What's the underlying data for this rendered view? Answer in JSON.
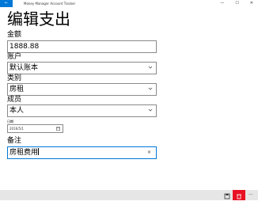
{
  "window": {
    "back_icon": "back-arrow-icon",
    "back_glyph": "←",
    "title": "Money Manager Account Tracker",
    "minimize_glyph": "—",
    "maximize_glyph": "☐",
    "close_glyph": "✕"
  },
  "page": {
    "title": "编辑支出"
  },
  "form": {
    "amount": {
      "label": "金额",
      "value": "1888.88"
    },
    "account": {
      "label": "账户",
      "value": "默认账本"
    },
    "category": {
      "label": "类别",
      "value": "房租"
    },
    "member": {
      "label": "成员",
      "value": "本人"
    },
    "date": {
      "label": "日期",
      "value": "2016/5/1"
    },
    "note": {
      "label": "备注",
      "value": "房租费用",
      "clear_glyph": "×"
    }
  },
  "commandbar": {
    "save_icon": "save-icon",
    "delete_icon": "delete-icon",
    "more_glyph": "···",
    "accent_delete": "#e81123"
  },
  "colors": {
    "accent": "#0078d7",
    "commandbar_bg": "#e6e6e6"
  }
}
